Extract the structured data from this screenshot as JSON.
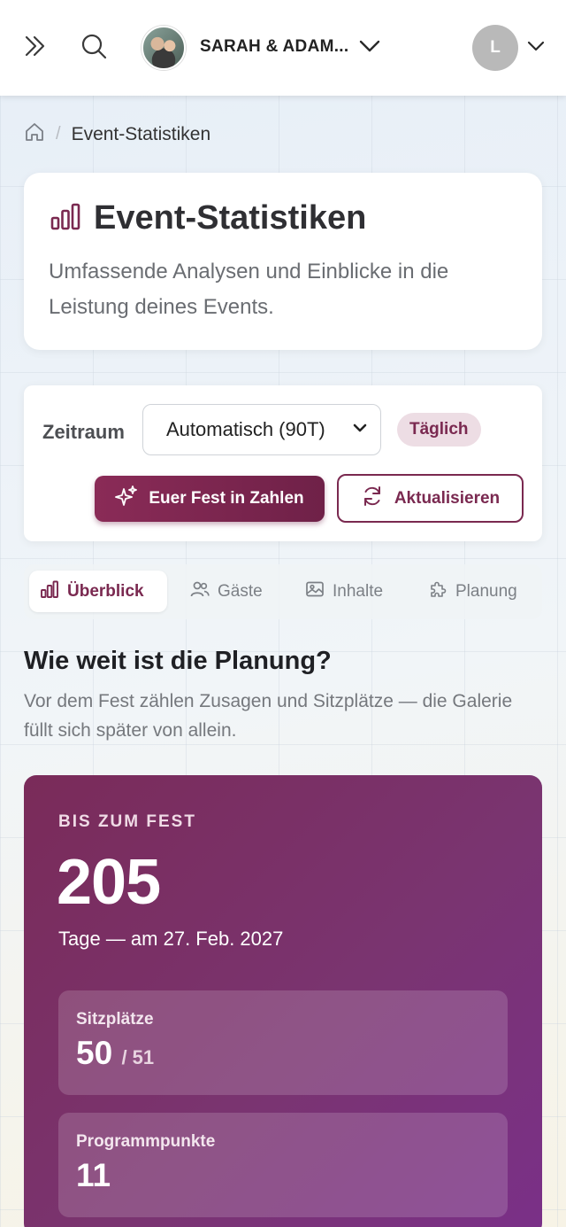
{
  "topbar": {
    "event_name": "SARAH & ADAM...",
    "user_initial": "L"
  },
  "breadcrumb": {
    "current": "Event-Statistiken"
  },
  "header": {
    "title": "Event-Statistiken",
    "description": "Umfassende Analysen und Einblicke in die Leistung deines Events."
  },
  "controls": {
    "period_label": "Zeitraum",
    "period_value": "Automatisch (90T)",
    "granularity_badge": "Täglich",
    "primary_button": "Euer Fest in Zahlen",
    "refresh_button": "Aktualisieren"
  },
  "tabs": [
    {
      "label": "Überblick",
      "icon": "bar-chart-icon",
      "active": true
    },
    {
      "label": "Gäste",
      "icon": "users-icon",
      "active": false
    },
    {
      "label": "Inhalte",
      "icon": "image-icon",
      "active": false
    },
    {
      "label": "Planung",
      "icon": "puzzle-icon",
      "active": false
    }
  ],
  "section": {
    "title": "Wie weit ist die Planung?",
    "description": "Vor dem Fest zählen Zusagen und Sitzplätze — die Galerie füllt sich später von allein."
  },
  "countdown": {
    "eyebrow": "BIS ZUM FEST",
    "days": "205",
    "subtitle": "Tage — am 27. Feb. 2027",
    "seats_label": "Sitzplätze",
    "seats_value": "50",
    "seats_total": "/ 51",
    "program_label": "Programmpunkte",
    "program_value": "11"
  },
  "colors": {
    "accent": "#7a2950",
    "hero_start": "#7a2b59",
    "hero_end": "#7a3088"
  }
}
